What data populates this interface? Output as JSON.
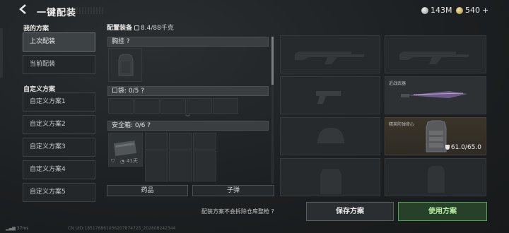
{
  "header": {
    "back_label": "<",
    "title": "一键配装",
    "currency_silver": "143M",
    "currency_gold": "540",
    "plus_label": "+"
  },
  "sidebar": {
    "my_plans_label": "我的方案",
    "my_plans": [
      {
        "label": "上次配装",
        "active": true
      },
      {
        "label": "当前配装",
        "active": false
      }
    ],
    "custom_plans_label": "自定义方案",
    "custom_plans": [
      "自定义方案1",
      "自定义方案2",
      "自定义方案3",
      "自定义方案4",
      "自定义方案5"
    ]
  },
  "equip": {
    "title": "配置装备",
    "weight": "8.4/88千克",
    "chest_label": "胸挂 ?",
    "pocket_label": "口袋: 0/5 ?",
    "safebox_label": "安全箱: 0/6 ?",
    "safebox_timer": "41天",
    "medicine_tab": "药品",
    "ammo_tab": "子弹"
  },
  "gear": {
    "melee_label": "近战武器",
    "armor_label": "精英防弹背心",
    "armor_durability": "61.0/65.0"
  },
  "bottom": {
    "note": "配装方案不会拆除仓库整枪 ?",
    "save_button": "保存方案",
    "use_button": "使用方案"
  },
  "footer": {
    "ping": "37ms",
    "uid": "CN UID:185176861036207874725_202608242344"
  }
}
